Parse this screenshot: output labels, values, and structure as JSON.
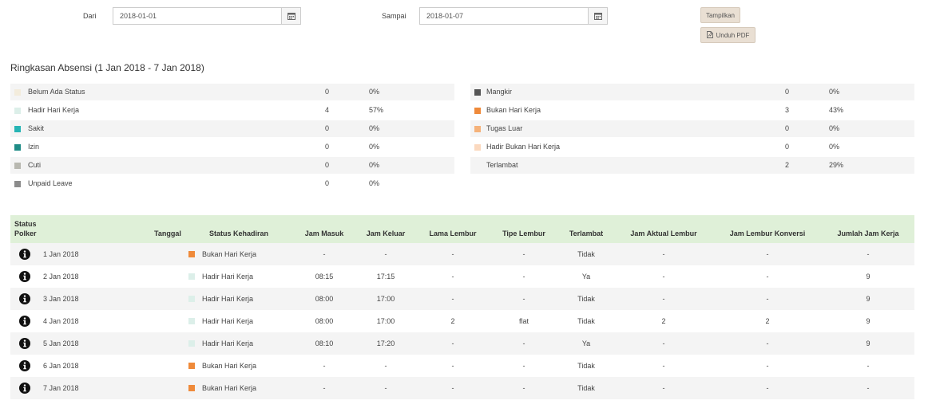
{
  "filter": {
    "from_label": "Dari",
    "from_value": "2018-01-01",
    "to_label": "Sampai",
    "to_value": "2018-01-07",
    "show_button": "Tampilkan",
    "download_button": "Unduh PDF"
  },
  "summary": {
    "title": "Ringkasan Absensi (1 Jan 2018 - 7 Jan 2018)",
    "left": [
      {
        "label": "Belum Ada Status",
        "count": "0",
        "pct": "0%",
        "color": "#f3ecdc"
      },
      {
        "label": "Hadir Hari Kerja",
        "count": "4",
        "pct": "57%",
        "color": "#dcefe9"
      },
      {
        "label": "Sakit",
        "count": "0",
        "pct": "0%",
        "color": "#26b4b4"
      },
      {
        "label": "Izin",
        "count": "0",
        "pct": "0%",
        "color": "#1f8c86"
      },
      {
        "label": "Cuti",
        "count": "0",
        "pct": "0%",
        "color": "#b8b8b0"
      },
      {
        "label": "Unpaid Leave",
        "count": "0",
        "pct": "0%",
        "color": "#8c8c8c"
      }
    ],
    "right": [
      {
        "label": "Mangkir",
        "count": "0",
        "pct": "0%",
        "color": "#555555"
      },
      {
        "label": "Bukan Hari Kerja",
        "count": "3",
        "pct": "43%",
        "color": "#ef8a3a"
      },
      {
        "label": "Tugas Luar",
        "count": "0",
        "pct": "0%",
        "color": "#f5b27a"
      },
      {
        "label": "Hadir Bukan Hari Kerja",
        "count": "0",
        "pct": "0%",
        "color": "#fbd9bf"
      },
      {
        "label": "Terlambat",
        "count": "2",
        "pct": "29%",
        "color": ""
      }
    ]
  },
  "table": {
    "headers": {
      "status_polker_1": "Status",
      "status_polker_2": "Polker",
      "tanggal": "Tanggal",
      "status_kehadiran": "Status Kehadiran",
      "jam_masuk": "Jam Masuk",
      "jam_keluar": "Jam Keluar",
      "lama_lembur": "Lama Lembur",
      "tipe_lembur": "Tipe Lembur",
      "terlambat": "Terlambat",
      "jam_aktual_lembur": "Jam Aktual Lembur",
      "jam_lembur_konversi": "Jam Lembur Konversi",
      "jumlah_jam_kerja": "Jumlah Jam Kerja"
    },
    "rows": [
      {
        "date": "1 Jan 2018",
        "status": "Bukan Hari Kerja",
        "status_color": "#ef8a3a",
        "in": "-",
        "out": "-",
        "ot_len": "-",
        "ot_type": "-",
        "late": "Tidak",
        "ot_actual": "-",
        "ot_conv": "-",
        "total": "-"
      },
      {
        "date": "2 Jan 2018",
        "status": "Hadir Hari Kerja",
        "status_color": "#dcefe9",
        "in": "08:15",
        "out": "17:15",
        "ot_len": "-",
        "ot_type": "-",
        "late": "Ya",
        "ot_actual": "-",
        "ot_conv": "-",
        "total": "9"
      },
      {
        "date": "3 Jan 2018",
        "status": "Hadir Hari Kerja",
        "status_color": "#dcefe9",
        "in": "08:00",
        "out": "17:00",
        "ot_len": "-",
        "ot_type": "-",
        "late": "Tidak",
        "ot_actual": "-",
        "ot_conv": "-",
        "total": "9"
      },
      {
        "date": "4 Jan 2018",
        "status": "Hadir Hari Kerja",
        "status_color": "#dcefe9",
        "in": "08:00",
        "out": "17:00",
        "ot_len": "2",
        "ot_type": "flat",
        "late": "Tidak",
        "ot_actual": "2",
        "ot_conv": "2",
        "total": "9"
      },
      {
        "date": "5 Jan 2018",
        "status": "Hadir Hari Kerja",
        "status_color": "#dcefe9",
        "in": "08:10",
        "out": "17:20",
        "ot_len": "-",
        "ot_type": "-",
        "late": "Ya",
        "ot_actual": "-",
        "ot_conv": "-",
        "total": "9"
      },
      {
        "date": "6 Jan 2018",
        "status": "Bukan Hari Kerja",
        "status_color": "#ef8a3a",
        "in": "-",
        "out": "-",
        "ot_len": "-",
        "ot_type": "-",
        "late": "Tidak",
        "ot_actual": "-",
        "ot_conv": "-",
        "total": "-"
      },
      {
        "date": "7 Jan 2018",
        "status": "Bukan Hari Kerja",
        "status_color": "#ef8a3a",
        "in": "-",
        "out": "-",
        "ot_len": "-",
        "ot_type": "-",
        "late": "Tidak",
        "ot_actual": "-",
        "ot_conv": "-",
        "total": "-"
      }
    ]
  }
}
